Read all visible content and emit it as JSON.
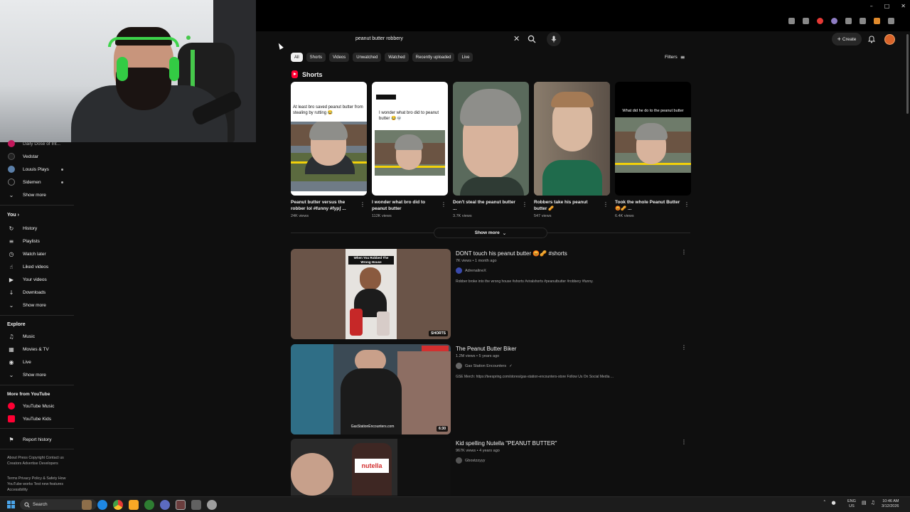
{
  "search": {
    "query": "peanut butter robbery"
  },
  "header": {
    "create_label": "Create"
  },
  "chips": [
    "All",
    "Shorts",
    "Videos",
    "Unwatched",
    "Watched",
    "Recently uploaded",
    "Live"
  ],
  "filters_label": "Filters",
  "shorts": {
    "heading": "Shorts",
    "items": [
      {
        "title": "Peanut butter versus the robber lol #funny #fypʃ ...",
        "views": "24K views",
        "caption": "At least bro saved peanut butter from stealing by rutting 😂"
      },
      {
        "title": "I wonder what bro did to peanut butter",
        "views": "112K views",
        "caption": "I wonder what bro did to peanut butter 😂💀"
      },
      {
        "title": "Don't steal the peanut butter ...",
        "views": "3.7K views",
        "caption": ""
      },
      {
        "title": "Robbers take his peanut butter 🥜",
        "views": "547 views",
        "caption": ""
      },
      {
        "title": "Took the whole Peanut Butter 😡🥜 ...",
        "views": "6.4K views",
        "caption": "What did he do to the peanut butter"
      }
    ],
    "show_more": "Show more"
  },
  "videos": [
    {
      "title": "DONT touch his peanut butter 😡🥜 #shorts",
      "meta": "7K views • 1 month ago",
      "channel": "AdrenalineX",
      "desc": "Robber broke into the wrong house #shorts #viralshorts #peanutbutter #robbery #funny.",
      "badge": "SHORTS",
      "overlay": "When You Robbed The Wrong House"
    },
    {
      "title": "The Peanut Butter Biker",
      "meta": "1.2M views • 5 years ago",
      "channel": "Gas Station Encounters",
      "desc": "GSE Merch: https://teespring.com/stores/gas-station-encounters-store Follow Us On Social Media ...",
      "badge": "6:30",
      "overlay": "GasStationEncounters.com"
    },
    {
      "title": "Kid spelling Nutella \"PEANUT BUTTER\"",
      "meta": "967K views • 4 years ago",
      "channel": "Gbostzzyyy",
      "desc": "",
      "badge": "",
      "overlay": "nutella"
    }
  ],
  "sidebar": {
    "subscriptions": [
      {
        "label": "Daily Dose of Int..."
      },
      {
        "label": "Vedstar"
      },
      {
        "label": "Louuis Plays"
      },
      {
        "label": "Sidemen"
      }
    ],
    "sub_show_more": "Show more",
    "you_heading": "You",
    "you_items": [
      "History",
      "Playlists",
      "Watch later",
      "Liked videos",
      "Your videos",
      "Downloads",
      "Show more"
    ],
    "explore_heading": "Explore",
    "explore_items": [
      "Music",
      "Movies & TV",
      "Live",
      "Show more"
    ],
    "more_heading": "More from YouTube",
    "more_items": [
      "YouTube Music",
      "YouTube Kids"
    ],
    "report_history": "Report history",
    "footer1": "About  Press  Copyright  Contact us  Creators  Advertise  Developers",
    "footer2": "Terms  Privacy  Policy & Safety  How YouTube works  Test new features  Accessibility"
  },
  "taskbar": {
    "search_label": "Search",
    "lang_top": "ENG",
    "lang_bottom": "US",
    "time": "10:46 AM",
    "date": "3/12/2026"
  }
}
